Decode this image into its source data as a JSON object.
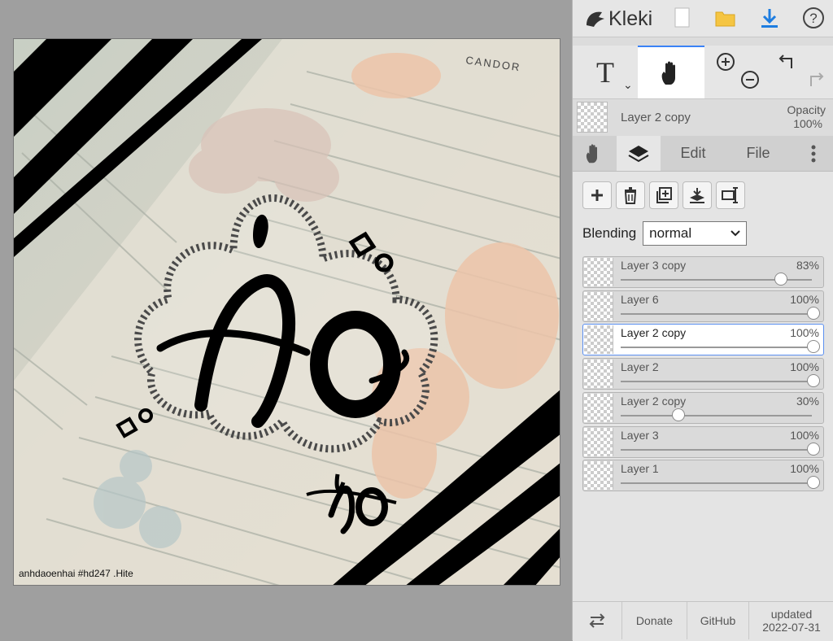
{
  "app": {
    "name": "Kleki"
  },
  "canvas": {
    "watermark": "anhdaoenhai #hd247 .Hite",
    "big_word": "Ao",
    "small_word": "Ao",
    "book_header": "CANDOR"
  },
  "header": {
    "icons": [
      "new-image-icon",
      "open-folder-icon",
      "download-icon",
      "help-icon"
    ]
  },
  "tools": {
    "text_label": "T",
    "items": [
      "text-tool",
      "hand-tool",
      "zoom-in",
      "zoom-out",
      "undo",
      "redo"
    ]
  },
  "current_layer": {
    "name": "Layer 2 copy",
    "opacity_label": "Opacity",
    "opacity_value": "100%"
  },
  "tabs": {
    "edit": "Edit",
    "file": "File"
  },
  "blending": {
    "label": "Blending",
    "value": "normal"
  },
  "layers": [
    {
      "name": "Layer 3 copy",
      "opacity": "83%",
      "level": 0.83,
      "selected": false
    },
    {
      "name": "Layer 6",
      "opacity": "100%",
      "level": 1.0,
      "selected": false
    },
    {
      "name": "Layer 2 copy",
      "opacity": "100%",
      "level": 1.0,
      "selected": true
    },
    {
      "name": "Layer 2",
      "opacity": "100%",
      "level": 1.0,
      "selected": false
    },
    {
      "name": "Layer 2 copy",
      "opacity": "30%",
      "level": 0.3,
      "selected": false
    },
    {
      "name": "Layer 3",
      "opacity": "100%",
      "level": 1.0,
      "selected": false
    },
    {
      "name": "Layer 1",
      "opacity": "100%",
      "level": 1.0,
      "selected": false
    }
  ],
  "footer": {
    "donate": "Donate",
    "github": "GitHub",
    "updated_label": "updated",
    "updated_date": "2022-07-31"
  },
  "colors": {
    "accent": "#3b82f6",
    "download": "#1e7de0",
    "folder": "#f5c542"
  }
}
